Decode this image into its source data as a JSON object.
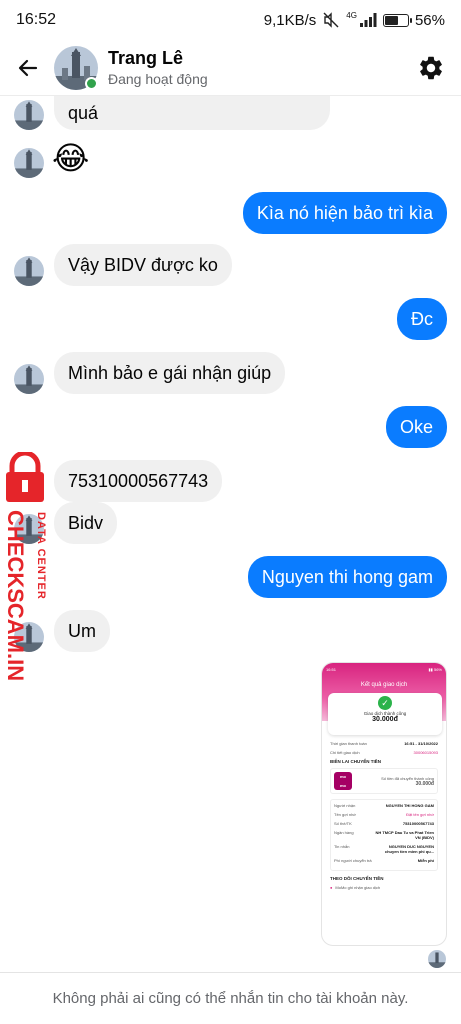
{
  "status_bar": {
    "time": "16:52",
    "network_speed": "9,1KB/s",
    "network_type": "4G",
    "battery": "56%",
    "battery_level": 0.56
  },
  "header": {
    "name": "Trang Lê",
    "status": "Đang hoạt động"
  },
  "messages": [
    {
      "side": "in",
      "text": "quá",
      "avatar": true
    },
    {
      "side": "in",
      "text": "😂",
      "avatar": true,
      "emoji": true
    },
    {
      "side": "out",
      "text": "Kìa nó hiện bảo trì kìa"
    },
    {
      "side": "in",
      "text": "Vậy BIDV được ko",
      "avatar": true
    },
    {
      "side": "out",
      "text": "Đc"
    },
    {
      "side": "in",
      "text": "Mình bảo e gái nhận giúp",
      "avatar": true
    },
    {
      "side": "out",
      "text": "Oke"
    },
    {
      "side": "in",
      "text": "75310000567743"
    },
    {
      "side": "in",
      "text": "Bidv",
      "avatar": true
    },
    {
      "side": "out",
      "text": "Nguyen thi hong gam"
    },
    {
      "side": "in",
      "text": "Um",
      "avatar": true
    }
  ],
  "receipt": {
    "status_time": "16:51",
    "title": "Kết quả giao dịch",
    "success": "Giao dịch thành công",
    "amount": "30.000đ",
    "time_label": "Thời gian thanh toán",
    "time_value": "16:51 - 31/10/2022",
    "detail_label": "Chi tiết giao dịch",
    "detail_value": "30006015093",
    "section": "BIÊN LAI CHUYỂN TIỀN",
    "momo_logo_1": "mo",
    "momo_logo_2": "mo",
    "transfer_label": "Số tiền đã chuyển thành công",
    "transfer_amount": "30.000đ",
    "receiver_label": "Người nhận",
    "receiver_value": "NGUYEN THI HONG GAM",
    "nickname_label": "Tên gợi nhớ",
    "nickname_value": "Đặt tên gợi nhớ",
    "account_label": "Số thẻ/TK",
    "account_value": "75310000567743",
    "bank_label": "Ngân hàng",
    "bank_value": "NH TMCP Dau Tu va Phat Trien VN (BIDV)",
    "message_label": "Tin nhắn",
    "message_value": "NGUYEN DUC NGUYEN chuyen tien mien phi qu...",
    "fee_label": "Phí người chuyển trả",
    "fee_value": "Miễn phí",
    "follow": "THEO DÕI CHUYỂN TIỀN",
    "momo_note": "MoMo ghi nhận giao dịch"
  },
  "watermark": {
    "line1": "DATA CENTER",
    "line2": "CHECKSCAM.INFO"
  },
  "footer": {
    "text": "Không phải ai cũng có thể nhắn tin cho tài khoản này."
  },
  "colors": {
    "outgoing": "#0a7cff",
    "incoming": "#f0f0f0",
    "online": "#31a24c",
    "watermark": "#e5252a"
  }
}
